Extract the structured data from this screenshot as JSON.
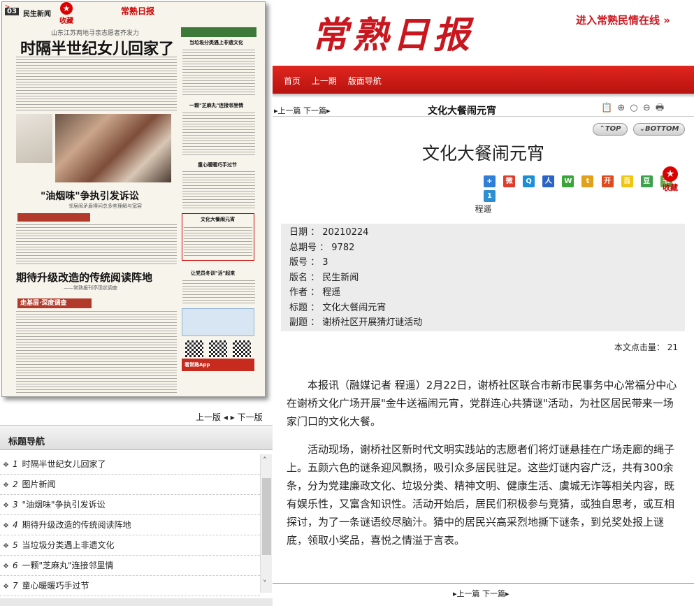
{
  "paper": {
    "section_no": "03",
    "section_name": "民生新闻",
    "masthead": "常熟日报",
    "fav_label": "收藏",
    "sub1": "山东江苏两地寻亲志愿者齐发力",
    "headline1": "时隔半世纪女儿回家了",
    "headline2": "\"油烟味\"争执引发诉讼",
    "sub2": "邻居闹矛盾得问总多些理解与宽容",
    "headline3": "期待升级改造的传统阅读阵地",
    "sub3": "——常熟报刊亭现状调查",
    "tag": "走基层·深度调查",
    "rt1": "当垃圾分类遇上非遗文化",
    "rt2": "一颗\"芝麻丸\"连接邻里情",
    "rt3": "童心暖暖巧手过节",
    "rt4": "文化大餐闹元宵",
    "rt5": "让党员冬训\"活\"起来",
    "app": "看常熟App"
  },
  "pager": {
    "prev": "上一版",
    "next": "下一版"
  },
  "nav": {
    "title": "标题导航",
    "items": [
      {
        "num": "1",
        "label": "时隔半世纪女儿回家了"
      },
      {
        "num": "2",
        "label": "图片新闻"
      },
      {
        "num": "3",
        "label": "\"油烟味\"争执引发诉讼"
      },
      {
        "num": "4",
        "label": "期待升级改造的传统阅读阵地"
      },
      {
        "num": "5",
        "label": "当垃圾分类遇上非遗文化"
      },
      {
        "num": "6",
        "label": "一颗\"芝麻丸\"连接邻里情"
      },
      {
        "num": "7",
        "label": "童心暖暖巧手过节"
      }
    ]
  },
  "header": {
    "logo": "常熟日报",
    "minqing": "进入常熟民情在线",
    "menu": [
      "首页",
      "上一期",
      "版面导航"
    ]
  },
  "toolbar": {
    "prev_next": "上一篇 下一篇",
    "title": "文化大餐闹元宵",
    "top": "TOP",
    "bottom": "BOTTOM"
  },
  "article": {
    "title": "文化大餐闹元宵",
    "author": "程遥",
    "fav_label": "收藏",
    "meta": [
      {
        "k": "日期",
        "v": "20210224"
      },
      {
        "k": "总期号",
        "v": "9782"
      },
      {
        "k": "版号",
        "v": "3"
      },
      {
        "k": "版名",
        "v": "民生新闻"
      },
      {
        "k": "作者",
        "v": "程遥"
      },
      {
        "k": "标题",
        "v": "文化大餐闹元宵"
      },
      {
        "k": "副题",
        "v": "谢桥社区开展猜灯谜活动"
      }
    ],
    "hits_label": "本文点击量：",
    "hits": "21",
    "paragraphs": [
      "本报讯（融媒记者 程遥）2月22日，谢桥社区联合市新市民事务中心常福分中心在谢桥文化广场开展\"金牛送福闹元宵，党群连心共猜谜\"活动，为社区居民带来一场家门口的文化大餐。",
      "活动现场，谢桥社区新时代文明实践站的志愿者们将灯谜悬挂在广场走廊的绳子上。五颜六色的谜条迎风飘扬，吸引众多居民驻足。这些灯谜内容广泛，共有300余条，分为党建廉政文化、垃圾分类、精神文明、健康生活、虞城无诈等相关内容，既有娱乐性，又富含知识性。活动开始后，居民们积极参与竞猜，或独自思考，或互相探讨，为了一条谜语绞尽脑汁。猜中的居民兴高采烈地撕下谜条，到兑奖处报上谜底，领取小奖品，喜悦之情溢于言表。"
    ]
  },
  "footer": {
    "prev_next": "上一篇 下一篇"
  },
  "colors": {
    "brand_red": "#c8171e",
    "meta_bg": "#ececec"
  }
}
